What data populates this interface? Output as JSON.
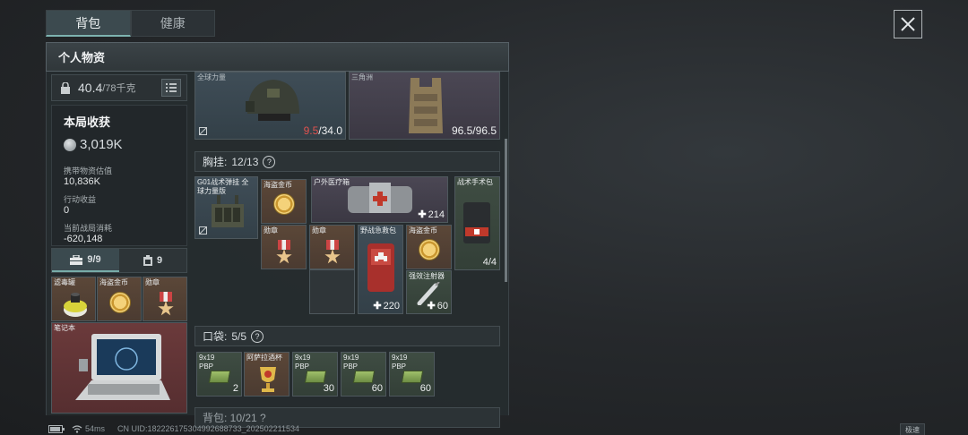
{
  "tabs": [
    {
      "label": "背包"
    },
    {
      "label": "健康"
    }
  ],
  "panel_title": "个人物资",
  "weight": {
    "current": "40.4",
    "max": "/78千克"
  },
  "earnings": {
    "title": "本局收获",
    "value": "3,019K",
    "stats": [
      {
        "label": "携带物资估值",
        "value": "10,836K"
      },
      {
        "label": "行动收益",
        "value": "0"
      },
      {
        "label": "当前战局消耗",
        "value": "-620,148"
      }
    ]
  },
  "slot_tabs": [
    {
      "label": "9/9"
    },
    {
      "label": "9"
    }
  ],
  "left_items": [
    {
      "label": "滤毒罐"
    },
    {
      "label": "海盗金币"
    },
    {
      "label": "勋章"
    },
    {
      "label": "笔记本"
    }
  ],
  "gear": [
    {
      "label": "全球力量",
      "durability_red": "9.5",
      "durability_rest": "/34.0"
    },
    {
      "label": "三角洲",
      "durability": "96.5/96.5"
    }
  ],
  "chest": {
    "title": "胸挂:",
    "count": "12/13"
  },
  "chest_items": [
    {
      "label": "G01战术弹挂 全球力量版"
    },
    {
      "label": "海盗金币"
    },
    {
      "label": "户外医疗箱",
      "count": "214"
    },
    {
      "label": "战术手术包",
      "count": "4/4"
    },
    {
      "label": "勋章"
    },
    {
      "label": "勋章"
    },
    {
      "label": "野战急救包",
      "count": "220"
    },
    {
      "label": "海盗金币"
    },
    {
      "label": "强效注射器",
      "count": "60"
    }
  ],
  "pocket": {
    "title": "口袋:",
    "count": "5/5"
  },
  "pocket_items": [
    {
      "label": "9x19 PBP",
      "count": "2"
    },
    {
      "label": "阿萨拉酒杯"
    },
    {
      "label": "9x19 PBP",
      "count": "30"
    },
    {
      "label": "9x19 PBP",
      "count": "60"
    },
    {
      "label": "9x19 PBP",
      "count": "60"
    }
  ],
  "next_section_partial": "背包: 10/21 ?",
  "footer": {
    "ping": "54ms",
    "uid": "CN UID:18222617530499268873​3_202502211534",
    "net": "极速"
  },
  "colors": {
    "accent": "#7db3b0",
    "durability_low": "#e0524f"
  }
}
